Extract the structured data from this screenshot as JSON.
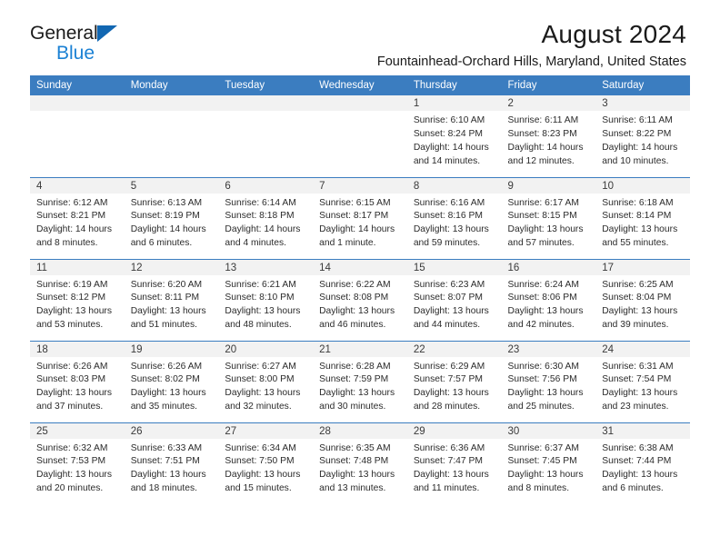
{
  "brand": {
    "name_primary": "General",
    "name_secondary": "Blue",
    "accent_color": "#1b81d4",
    "triangle_color": "#1267b2"
  },
  "header": {
    "title": "August 2024",
    "subtitle": "Fountainhead-Orchard Hills, Maryland, United States"
  },
  "calendar": {
    "header_bg": "#3b7dc0",
    "daynum_bg": "#f2f2f2",
    "weekday_headers": [
      "Sunday",
      "Monday",
      "Tuesday",
      "Wednesday",
      "Thursday",
      "Friday",
      "Saturday"
    ],
    "weeks": [
      [
        {
          "day": "",
          "lines": []
        },
        {
          "day": "",
          "lines": []
        },
        {
          "day": "",
          "lines": []
        },
        {
          "day": "",
          "lines": []
        },
        {
          "day": "1",
          "lines": [
            "Sunrise: 6:10 AM",
            "Sunset: 8:24 PM",
            "Daylight: 14 hours",
            "and 14 minutes."
          ]
        },
        {
          "day": "2",
          "lines": [
            "Sunrise: 6:11 AM",
            "Sunset: 8:23 PM",
            "Daylight: 14 hours",
            "and 12 minutes."
          ]
        },
        {
          "day": "3",
          "lines": [
            "Sunrise: 6:11 AM",
            "Sunset: 8:22 PM",
            "Daylight: 14 hours",
            "and 10 minutes."
          ]
        }
      ],
      [
        {
          "day": "4",
          "lines": [
            "Sunrise: 6:12 AM",
            "Sunset: 8:21 PM",
            "Daylight: 14 hours",
            "and 8 minutes."
          ]
        },
        {
          "day": "5",
          "lines": [
            "Sunrise: 6:13 AM",
            "Sunset: 8:19 PM",
            "Daylight: 14 hours",
            "and 6 minutes."
          ]
        },
        {
          "day": "6",
          "lines": [
            "Sunrise: 6:14 AM",
            "Sunset: 8:18 PM",
            "Daylight: 14 hours",
            "and 4 minutes."
          ]
        },
        {
          "day": "7",
          "lines": [
            "Sunrise: 6:15 AM",
            "Sunset: 8:17 PM",
            "Daylight: 14 hours",
            "and 1 minute."
          ]
        },
        {
          "day": "8",
          "lines": [
            "Sunrise: 6:16 AM",
            "Sunset: 8:16 PM",
            "Daylight: 13 hours",
            "and 59 minutes."
          ]
        },
        {
          "day": "9",
          "lines": [
            "Sunrise: 6:17 AM",
            "Sunset: 8:15 PM",
            "Daylight: 13 hours",
            "and 57 minutes."
          ]
        },
        {
          "day": "10",
          "lines": [
            "Sunrise: 6:18 AM",
            "Sunset: 8:14 PM",
            "Daylight: 13 hours",
            "and 55 minutes."
          ]
        }
      ],
      [
        {
          "day": "11",
          "lines": [
            "Sunrise: 6:19 AM",
            "Sunset: 8:12 PM",
            "Daylight: 13 hours",
            "and 53 minutes."
          ]
        },
        {
          "day": "12",
          "lines": [
            "Sunrise: 6:20 AM",
            "Sunset: 8:11 PM",
            "Daylight: 13 hours",
            "and 51 minutes."
          ]
        },
        {
          "day": "13",
          "lines": [
            "Sunrise: 6:21 AM",
            "Sunset: 8:10 PM",
            "Daylight: 13 hours",
            "and 48 minutes."
          ]
        },
        {
          "day": "14",
          "lines": [
            "Sunrise: 6:22 AM",
            "Sunset: 8:08 PM",
            "Daylight: 13 hours",
            "and 46 minutes."
          ]
        },
        {
          "day": "15",
          "lines": [
            "Sunrise: 6:23 AM",
            "Sunset: 8:07 PM",
            "Daylight: 13 hours",
            "and 44 minutes."
          ]
        },
        {
          "day": "16",
          "lines": [
            "Sunrise: 6:24 AM",
            "Sunset: 8:06 PM",
            "Daylight: 13 hours",
            "and 42 minutes."
          ]
        },
        {
          "day": "17",
          "lines": [
            "Sunrise: 6:25 AM",
            "Sunset: 8:04 PM",
            "Daylight: 13 hours",
            "and 39 minutes."
          ]
        }
      ],
      [
        {
          "day": "18",
          "lines": [
            "Sunrise: 6:26 AM",
            "Sunset: 8:03 PM",
            "Daylight: 13 hours",
            "and 37 minutes."
          ]
        },
        {
          "day": "19",
          "lines": [
            "Sunrise: 6:26 AM",
            "Sunset: 8:02 PM",
            "Daylight: 13 hours",
            "and 35 minutes."
          ]
        },
        {
          "day": "20",
          "lines": [
            "Sunrise: 6:27 AM",
            "Sunset: 8:00 PM",
            "Daylight: 13 hours",
            "and 32 minutes."
          ]
        },
        {
          "day": "21",
          "lines": [
            "Sunrise: 6:28 AM",
            "Sunset: 7:59 PM",
            "Daylight: 13 hours",
            "and 30 minutes."
          ]
        },
        {
          "day": "22",
          "lines": [
            "Sunrise: 6:29 AM",
            "Sunset: 7:57 PM",
            "Daylight: 13 hours",
            "and 28 minutes."
          ]
        },
        {
          "day": "23",
          "lines": [
            "Sunrise: 6:30 AM",
            "Sunset: 7:56 PM",
            "Daylight: 13 hours",
            "and 25 minutes."
          ]
        },
        {
          "day": "24",
          "lines": [
            "Sunrise: 6:31 AM",
            "Sunset: 7:54 PM",
            "Daylight: 13 hours",
            "and 23 minutes."
          ]
        }
      ],
      [
        {
          "day": "25",
          "lines": [
            "Sunrise: 6:32 AM",
            "Sunset: 7:53 PM",
            "Daylight: 13 hours",
            "and 20 minutes."
          ]
        },
        {
          "day": "26",
          "lines": [
            "Sunrise: 6:33 AM",
            "Sunset: 7:51 PM",
            "Daylight: 13 hours",
            "and 18 minutes."
          ]
        },
        {
          "day": "27",
          "lines": [
            "Sunrise: 6:34 AM",
            "Sunset: 7:50 PM",
            "Daylight: 13 hours",
            "and 15 minutes."
          ]
        },
        {
          "day": "28",
          "lines": [
            "Sunrise: 6:35 AM",
            "Sunset: 7:48 PM",
            "Daylight: 13 hours",
            "and 13 minutes."
          ]
        },
        {
          "day": "29",
          "lines": [
            "Sunrise: 6:36 AM",
            "Sunset: 7:47 PM",
            "Daylight: 13 hours",
            "and 11 minutes."
          ]
        },
        {
          "day": "30",
          "lines": [
            "Sunrise: 6:37 AM",
            "Sunset: 7:45 PM",
            "Daylight: 13 hours",
            "and 8 minutes."
          ]
        },
        {
          "day": "31",
          "lines": [
            "Sunrise: 6:38 AM",
            "Sunset: 7:44 PM",
            "Daylight: 13 hours",
            "and 6 minutes."
          ]
        }
      ]
    ]
  }
}
